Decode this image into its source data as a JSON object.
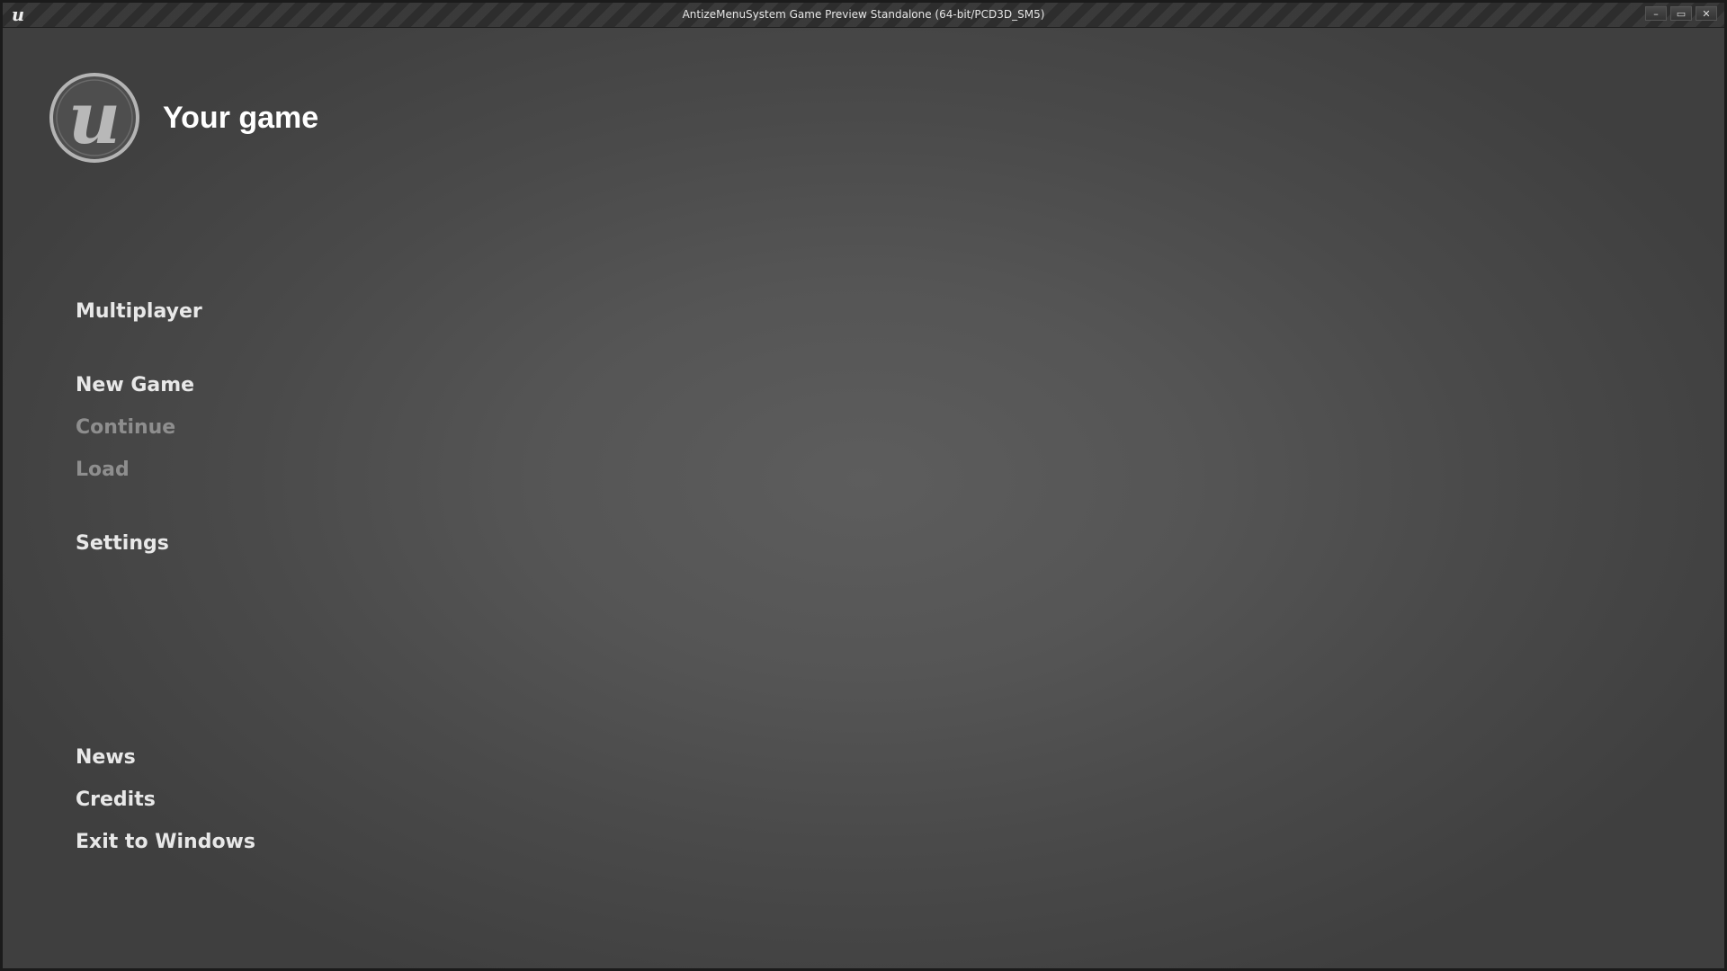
{
  "window": {
    "title": "AntizeMenuSystem Game Preview Standalone (64-bit/PCD3D_SM5)",
    "controls": {
      "minimize": "–",
      "maximize": "▭",
      "close": "✕"
    }
  },
  "brand": {
    "title": "Your game",
    "logo_icon": "unreal-logo-icon"
  },
  "menu": {
    "multiplayer": "Multiplayer",
    "new_game": "New Game",
    "continue": "Continue",
    "load": "Load",
    "settings": "Settings",
    "news": "News",
    "credits": "Credits",
    "exit": "Exit to Windows"
  },
  "colors": {
    "menu_text": "#e8e8e8",
    "menu_text_disabled": "#8e8e8e",
    "title_text": "#ffffff"
  }
}
